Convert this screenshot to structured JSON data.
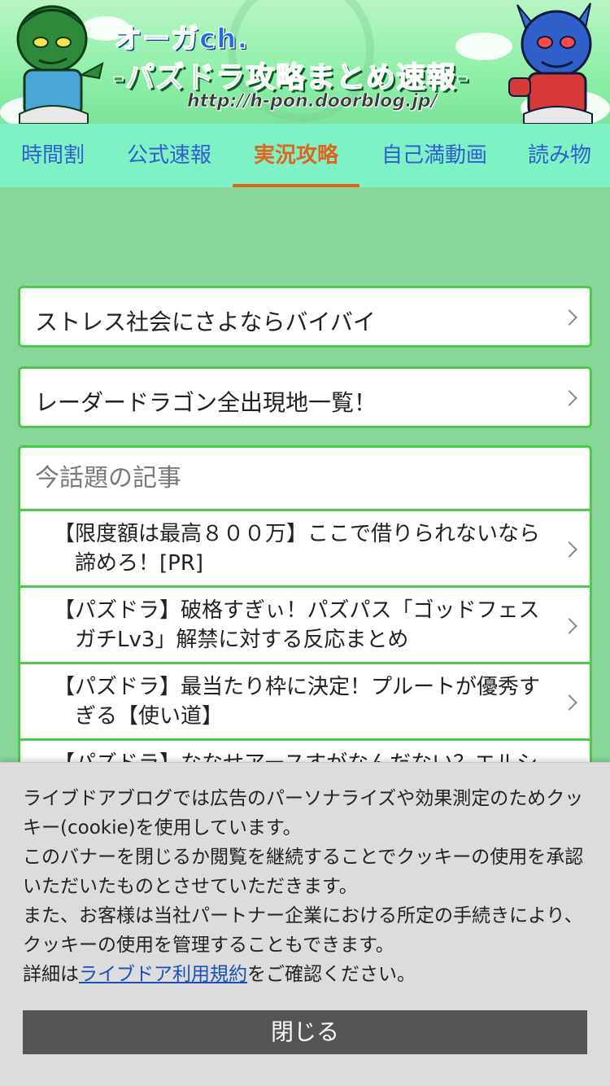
{
  "header": {
    "site_name": "オーガch.",
    "subtitle": "-パズドラ攻略まとめ速報-",
    "url": "http://h-pon.doorblog.jp/"
  },
  "tabs": [
    {
      "label": "時間割",
      "active": false
    },
    {
      "label": "公式速報",
      "active": false
    },
    {
      "label": "実況攻略",
      "active": true
    },
    {
      "label": "自己満動画",
      "active": false
    },
    {
      "label": "読み物",
      "active": false
    }
  ],
  "links": [
    {
      "label": "ストレス社会にさよならバイバイ"
    },
    {
      "label": "レーダードラゴン全出現地一覧！"
    }
  ],
  "trending": {
    "heading": "今話題の記事",
    "items": [
      {
        "title": "【限度額は最高８００万】ここで借りられないなら諦めろ！[PR]"
      },
      {
        "title": "【パズドラ】破格すぎぃ！パズパス「ゴッドフェスガチLv3」解禁に対する反応まとめ"
      },
      {
        "title": "【パズドラ】最当たり枠に決定！プルートが優秀すぎる【使い道】"
      },
      {
        "title": "【パズドラ】ななせアースすがなんだない？エルシー"
      }
    ]
  },
  "cookie_notice": {
    "para1": "ライブドアブログでは広告のパーソナライズや効果測定のためクッキー(cookie)を使用しています。",
    "para2": "このバナーを閉じるか閲覧を継続することでクッキーの使用を承認いただいたものとさせていただきます。",
    "para3": "また、お客様は当社パートナー企業における所定の手続きにより、クッキーの使用を管理することもできます。",
    "detail_prefix": "詳細は",
    "terms_link": "ライブドア利用規約",
    "detail_suffix": "をご確認ください。",
    "close_label": "閉じる"
  },
  "colors": {
    "tab_active": "#e0651f",
    "tab_inactive": "#2f5fcf",
    "card_border": "#4bcb48",
    "page_bg": "#88d69a"
  }
}
